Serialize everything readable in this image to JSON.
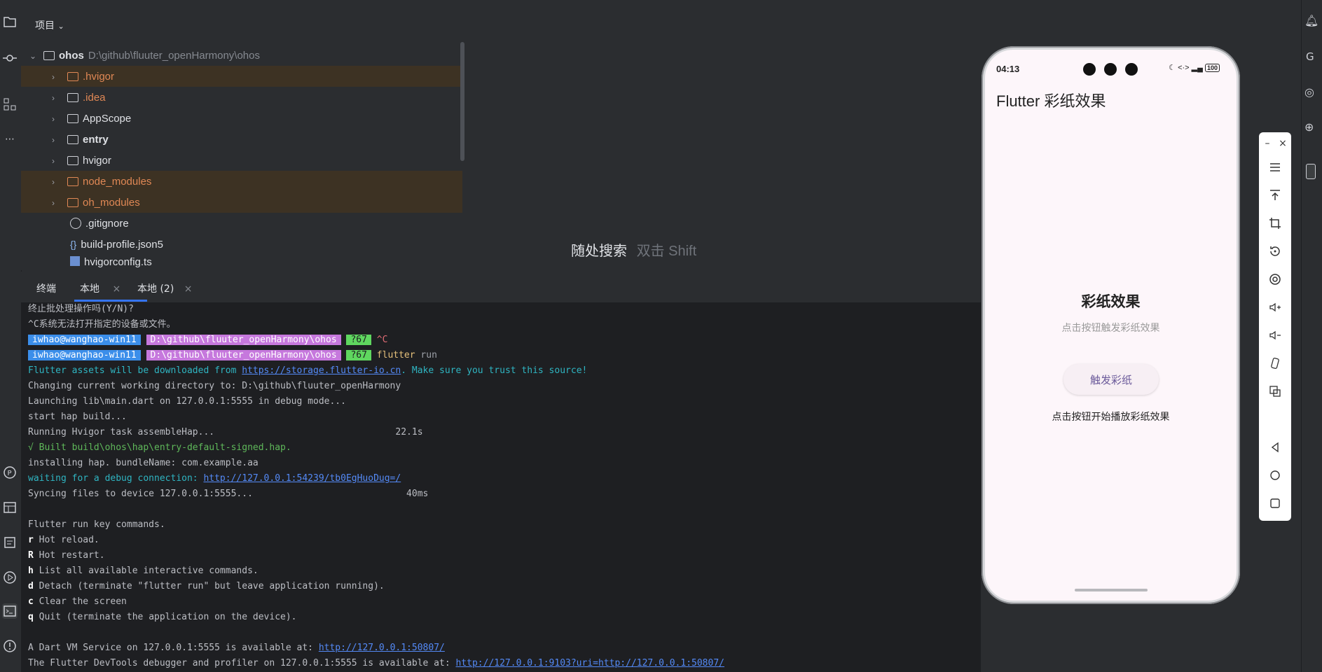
{
  "project": {
    "header": "项目",
    "root": {
      "name": "ohos",
      "path": "D:\\github\\fluuter_openHarmony\\ohos"
    },
    "items": [
      {
        "label": ".hvigor",
        "kind": "folder",
        "excluded": true
      },
      {
        "label": ".idea",
        "kind": "folder",
        "excluded": false
      },
      {
        "label": "AppScope",
        "kind": "folder",
        "excluded": false
      },
      {
        "label": "entry",
        "kind": "module",
        "excluded": false
      },
      {
        "label": "hvigor",
        "kind": "folder",
        "excluded": false
      },
      {
        "label": "node_modules",
        "kind": "folder",
        "excluded": true
      },
      {
        "label": "oh_modules",
        "kind": "folder",
        "excluded": true
      },
      {
        "label": ".gitignore",
        "kind": "file"
      },
      {
        "label": "build-profile.json5",
        "kind": "json"
      },
      {
        "label": "hvigorconfig.ts",
        "kind": "file"
      }
    ]
  },
  "search_hint": {
    "main": "随处搜索",
    "shortcut": "双击 Shift"
  },
  "terminal": {
    "title": "终端",
    "tabs": [
      "本地",
      "本地 (2)"
    ],
    "lines": {
      "l1": "终止批处理操作吗(Y/N)?",
      "l2": "^C系统无法打开指定的设备或文件。",
      "prompt_user": "iwhao@wanghao-win11",
      "prompt_path": "D:\\github\\fluuter_openHarmony\\ohos",
      "prompt_branch": "?67",
      "p1_cmd": "^C",
      "p2_cmd1": "flutter",
      "p2_cmd2": " run",
      "l5a": "Flutter assets will be downloaded from ",
      "l5link": "https://storage.flutter-io.cn",
      "l5b": ". Make sure you trust this source!",
      "l6": "Changing current working directory to: D:\\github\\fluuter_openHarmony",
      "l7": "Launching lib\\main.dart on 127.0.0.1:5555 in debug mode...",
      "l8": "start hap build...",
      "l9": "Running Hvigor task assembleHap...                                 22.1s",
      "l10": "√ Built build\\ohos\\hap\\entry-default-signed.hap.",
      "l11": "installing hap. bundleName: com.example.aa",
      "l12a": "waiting for a debug connection: ",
      "l12link": "http://127.0.0.1:54239/tb0EgHuoDug=/",
      "l13": "Syncing files to device 127.0.0.1:5555...                            40ms",
      "l15": "Flutter run key commands.",
      "k_r": "r",
      "k_r_t": " Hot reload.",
      "k_R": "R",
      "k_R_t": " Hot restart.",
      "k_h": "h",
      "k_h_t": " List all available interactive commands.",
      "k_d": "d",
      "k_d_t": " Detach (terminate \"flutter run\" but leave application running).",
      "k_c": "c",
      "k_c_t": " Clear the screen",
      "k_q": "q",
      "k_q_t": " Quit (terminate the application on the device).",
      "l23a": "A Dart VM Service on 127.0.0.1:5555 is available at: ",
      "l23link": "http://127.0.0.1:50807/",
      "l24a": "The Flutter DevTools debugger and profiler on 127.0.0.1:5555 is available at: ",
      "l24link": "http://127.0.0.1:9103?uri=http://127.0.0.1:50807/"
    }
  },
  "phone": {
    "time": "04:13",
    "battery": "100",
    "app_title": "Flutter 彩纸效果",
    "content_title": "彩纸效果",
    "content_subtitle": "点击按钮触发彩纸效果",
    "button_label": "触发彩纸",
    "hint": "点击按钮开始播放彩纸效果"
  },
  "colors": {
    "accent": "#548af7",
    "folder_excluded": "#e08855",
    "phone_bg": "#fdf6fa"
  }
}
